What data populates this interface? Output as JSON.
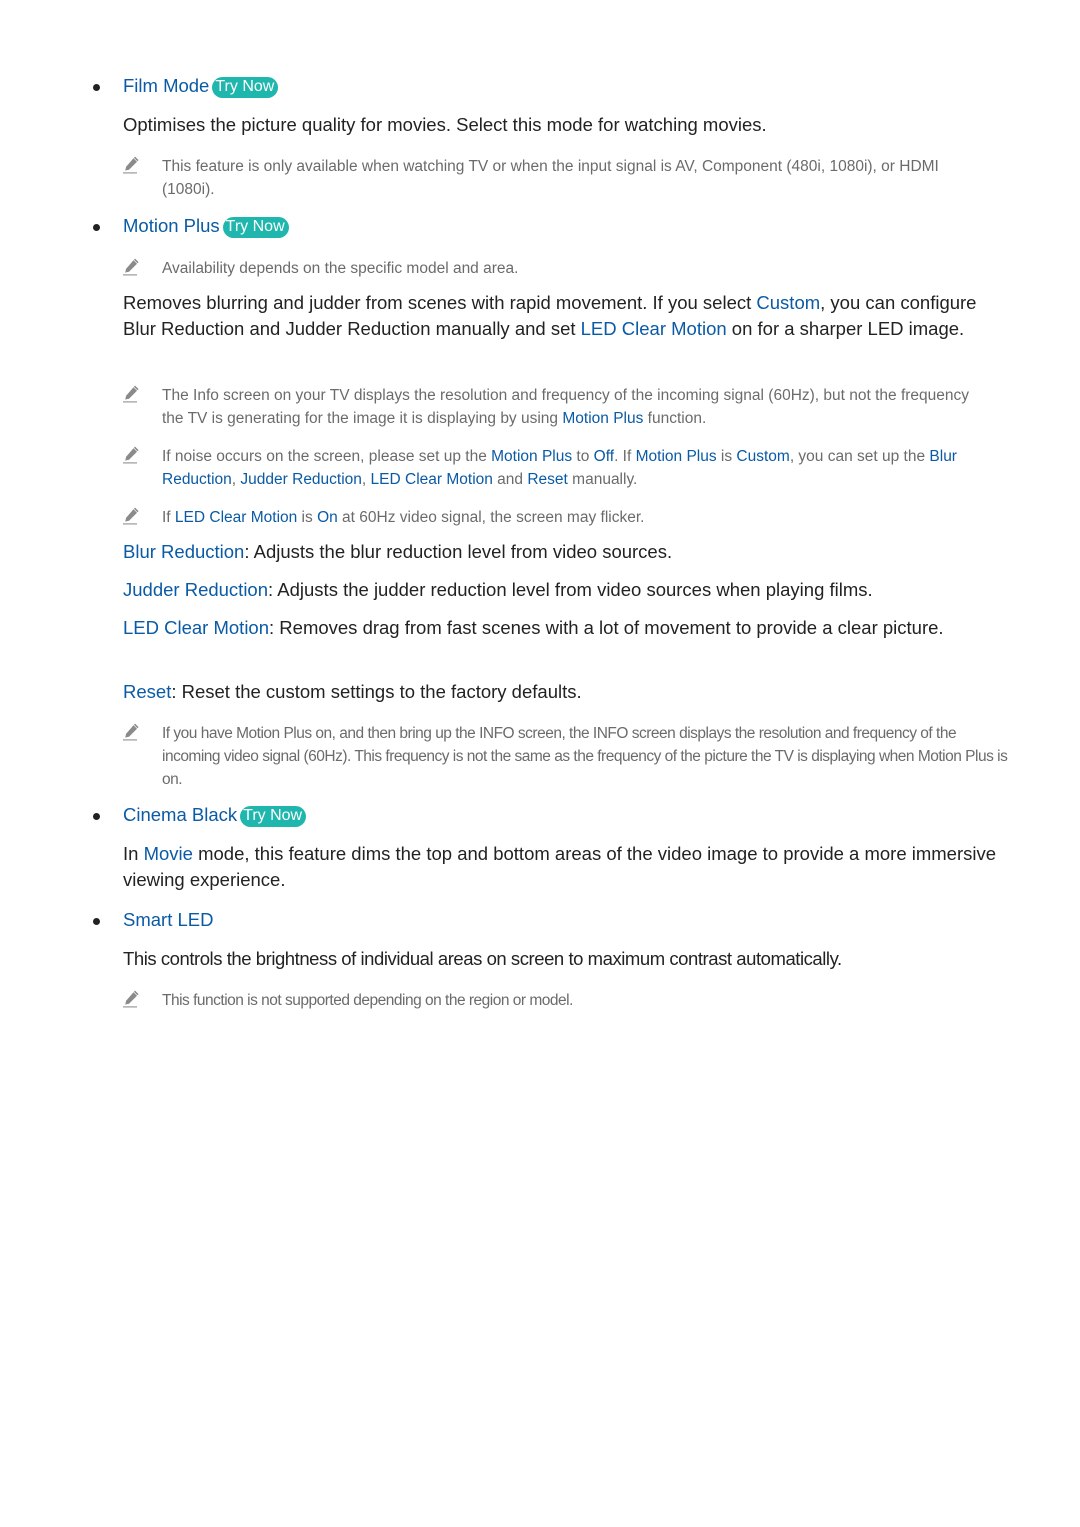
{
  "colors": {
    "link": "#0a5aa5",
    "try_now_bg": "#1fb6ae",
    "body_text": "#222222",
    "note_text": "#6b6b6b"
  },
  "try_now_label": "Try Now",
  "note_icon": "pencil-icon",
  "film_mode": {
    "title": "Film Mode",
    "description": "Optimises the picture quality for movies. Select this mode for watching movies.",
    "note": "This feature is only available when watching TV or when the input signal is AV, Component (480i, 1080i), or HDMI (1080i)."
  },
  "motion_plus": {
    "title": "Motion Plus",
    "note_availability": "Availability depends on the specific model and area.",
    "desc_parts": [
      "Removes blurring and judder from scenes with rapid movement. If you select ",
      "Custom",
      ", you can configure Blur Reduction and Judder Reduction manually and set ",
      "LED Clear Motion",
      " on for a sharper LED image."
    ],
    "note_info_parts": [
      "The Info screen on your TV displays the resolution and frequency of the incoming signal (60Hz), but not the frequency the TV is generating for the image it is displaying by using ",
      "Motion Plus",
      " function."
    ],
    "note_noise_parts": [
      "If noise occurs on the screen, please set up the ",
      "Motion Plus",
      " to ",
      "Off",
      ". If ",
      "Motion Plus",
      " is ",
      "Custom",
      ", you can set up the ",
      "Blur Reduction",
      ", ",
      "Judder Reduction",
      ", ",
      "LED Clear Motion",
      " and ",
      "Reset",
      " manually."
    ],
    "note_flicker_parts": [
      "If ",
      "LED Clear Motion",
      " is ",
      "On",
      " at 60Hz video signal, the screen may flicker."
    ],
    "options": [
      {
        "term": "Blur Reduction",
        "desc": ": Adjusts the blur reduction level from video sources."
      },
      {
        "term": "Judder Reduction",
        "desc": ": Adjusts the judder reduction level from video sources when playing films."
      },
      {
        "term": "LED Clear Motion",
        "desc": ": Removes drag from fast scenes with a lot of movement to provide a clear picture."
      },
      {
        "term": "Reset",
        "desc": ": Reset the custom settings to the factory defaults."
      }
    ],
    "note_info_screen": "If you have Motion Plus on, and then bring up the INFO screen, the INFO screen displays the resolution and frequency of the incoming video signal (60Hz). This frequency is not the same as the frequency of the picture the TV is displaying when Motion Plus is on."
  },
  "cinema_black": {
    "title": "Cinema Black",
    "desc_parts": [
      "In ",
      "Movie",
      " mode, this feature dims the top and bottom areas of the video image to provide a more immersive viewing experience."
    ]
  },
  "smart_led": {
    "title": "Smart LED",
    "description": "This controls the brightness of individual areas on screen to maximum contrast automatically.",
    "note": "This function is not supported depending on the region or model."
  }
}
